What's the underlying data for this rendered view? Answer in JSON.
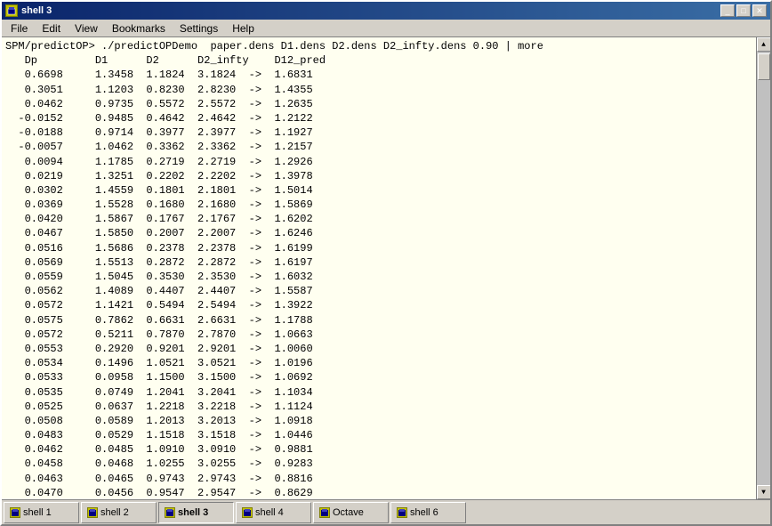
{
  "window": {
    "title": "shell 3",
    "icon": "terminal-icon"
  },
  "title_buttons": {
    "minimize": "_",
    "maximize": "□",
    "close": "✕"
  },
  "menu": {
    "items": [
      "File",
      "Edit",
      "View",
      "Bookmarks",
      "Settings",
      "Help"
    ]
  },
  "terminal": {
    "command_line": "SPM/predictOP> ./predictOPDemo  paper.dens D1.dens D2.dens D2_infty.dens 0.90 | more",
    "content": "   Dp         D1      D2      D2_infty    D12_pred\n   0.6698     1.3458  1.1824  3.1824  ->  1.6831\n   0.3051     1.1203  0.8230  2.8230  ->  1.4355\n   0.0462     0.9735  0.5572  2.5572  ->  1.2635\n  -0.0152     0.9485  0.4642  2.4642  ->  1.2122\n  -0.0188     0.9714  0.3977  2.3977  ->  1.1927\n  -0.0057     1.0462  0.3362  2.3362  ->  1.2157\n   0.0094     1.1785  0.2719  2.2719  ->  1.2926\n   0.0219     1.3251  0.2202  2.2202  ->  1.3978\n   0.0302     1.4559  0.1801  2.1801  ->  1.5014\n   0.0369     1.5528  0.1680  2.1680  ->  1.5869\n   0.0420     1.5867  0.1767  2.1767  ->  1.6202\n   0.0467     1.5850  0.2007  2.2007  ->  1.6246\n   0.0516     1.5686  0.2378  2.2378  ->  1.6199\n   0.0569     1.5513  0.2872  2.2872  ->  1.6197\n   0.0559     1.5045  0.3530  2.3530  ->  1.6032\n   0.0562     1.4089  0.4407  2.4407  ->  1.5587\n   0.0572     1.1421  0.5494  2.5494  ->  1.3922\n   0.0575     0.7862  0.6631  2.6631  ->  1.1788\n   0.0572     0.5211  0.7870  2.7870  ->  1.0663\n   0.0553     0.2920  0.9201  2.9201  ->  1.0060\n   0.0534     0.1496  1.0521  3.0521  ->  1.0196\n   0.0533     0.0958  1.1500  3.1500  ->  1.0692\n   0.0535     0.0749  1.2041  3.2041  ->  1.1034\n   0.0525     0.0637  1.2218  3.2218  ->  1.1124\n   0.0508     0.0589  1.2013  3.2013  ->  1.0918\n   0.0483     0.0529  1.1518  3.1518  ->  1.0446\n   0.0462     0.0485  1.0910  3.0910  ->  0.9881\n   0.0458     0.0468  1.0255  3.0255  ->  0.9283\n   0.0463     0.0465  0.9743  2.9743  ->  0.8816\n   0.0470     0.0456  0.9547  2.9547  ->  0.8629"
  },
  "taskbar": {
    "tabs": [
      {
        "label": "shell 1",
        "active": false
      },
      {
        "label": "shell 2",
        "active": false
      },
      {
        "label": "shell 3",
        "active": true
      },
      {
        "label": "shell 4",
        "active": false
      },
      {
        "label": "Octave",
        "active": false
      },
      {
        "label": "shell 6",
        "active": false
      }
    ]
  }
}
